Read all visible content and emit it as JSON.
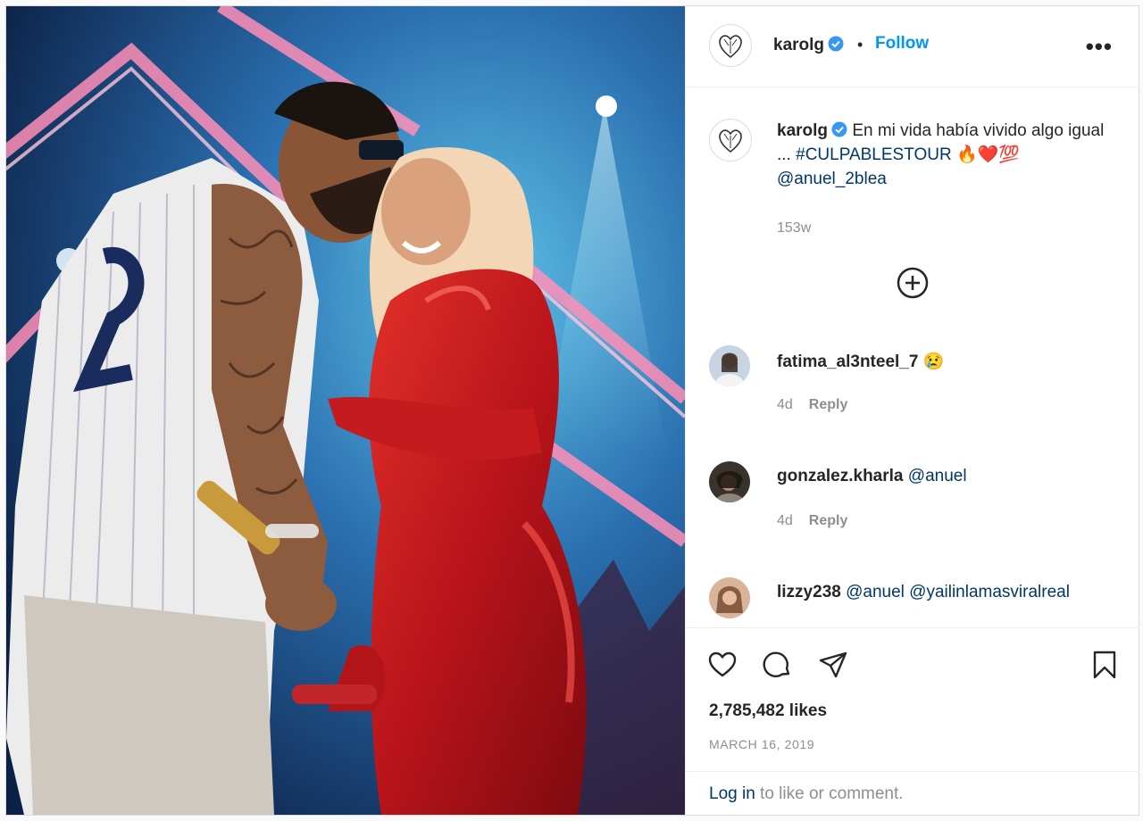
{
  "post": {
    "image_alt": "Concert photo",
    "author": "karolg",
    "follow_label": "Follow",
    "more_label": "•••",
    "caption": {
      "username": "karolg",
      "text": "En mi vida había vivido algo igual ...",
      "hashtag": "#CULPABLESTOUR",
      "emoji": "🔥❤️💯",
      "mention": "@anuel_2blea",
      "time": "153w"
    },
    "comments": [
      {
        "username": "fatima_al3nteel_7",
        "text": "😢",
        "time": "4d",
        "reply": "Reply"
      },
      {
        "username": "gonzalez.kharla",
        "text": "@anuel",
        "time": "4d",
        "reply": "Reply"
      },
      {
        "username": "lizzy238",
        "text": "@anuel @yailinlamasviralreal"
      }
    ],
    "likes": "2,785,482 likes",
    "date": "MARCH 16, 2019",
    "login": {
      "link": "Log in",
      "rest": " to like or comment."
    }
  },
  "icons": {
    "like": "heart-icon",
    "comment": "comment-icon",
    "share": "share-icon",
    "save": "bookmark-icon",
    "verified": "verified-badge-icon",
    "add": "plus-circle-icon"
  },
  "colors": {
    "accent": "#0095f6",
    "link": "#00376b",
    "muted": "#8e8e8e",
    "verified": "#3897f0"
  }
}
